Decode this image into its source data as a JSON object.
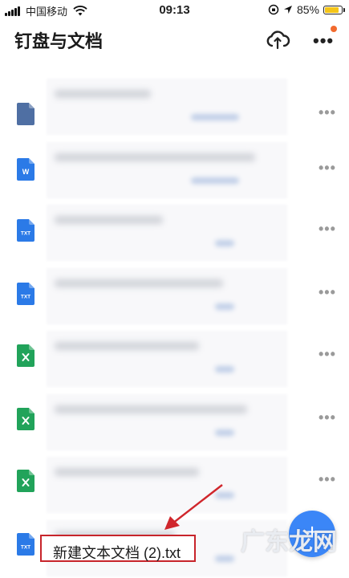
{
  "status_bar": {
    "carrier": "中国移动",
    "time": "09:13",
    "battery": "85%",
    "battery_level": 0.85
  },
  "header": {
    "title": "钉盘与文档",
    "icons": [
      "cloud-sync-icon",
      "more-icon"
    ]
  },
  "breadcrumb": "...",
  "files": [
    {
      "type": "file",
      "color": "#4f6fa3"
    },
    {
      "type": "W",
      "color": "#2b7ae7"
    },
    {
      "type": "TXT",
      "color": "#2b7ae7"
    },
    {
      "type": "TXT",
      "color": "#2b7ae7"
    },
    {
      "type": "X",
      "color": "#21a35a"
    },
    {
      "type": "X",
      "color": "#21a35a"
    },
    {
      "type": "X",
      "color": "#21a35a"
    },
    {
      "type": "TXT",
      "color": "#2b7ae7"
    }
  ],
  "highlighted_file": {
    "name": "新建文本文档 (2).txt"
  },
  "fab": {
    "label": "+"
  },
  "watermark": "广东龙网",
  "colors": {
    "accent": "#3b86f7",
    "highlight_border": "#c7242b",
    "notification": "#f26a2e"
  }
}
